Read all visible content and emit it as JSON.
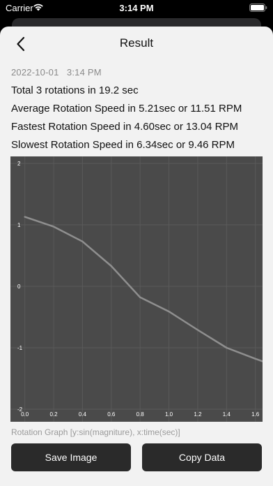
{
  "status_bar": {
    "carrier": "Carrier",
    "time": "3:14 PM"
  },
  "nav": {
    "title": "Result",
    "back_icon": "chevron-left-icon"
  },
  "result": {
    "timestamp": "2022-10-01   3:14 PM",
    "total": "Total 3 rotations in 19.2 sec",
    "average": "Average Rotation Speed in 5.21sec or 11.51 RPM",
    "fastest": "Fastest Rotation Speed in 4.60sec or 13.04 RPM",
    "slowest": "Slowest Rotation Speed in 6.34sec or 9.46 RPM"
  },
  "chart_caption": "Rotation Graph [y:sin(magniture), x:time(sec)]",
  "buttons": {
    "save": "Save Image",
    "copy": "Copy Data"
  },
  "colors": {
    "chart_background": "#4a4a4a",
    "grid": "#5a5a5a",
    "line": "#8f8f8f",
    "tick_label": "#ffffff"
  },
  "chart_data": {
    "type": "line",
    "title": "",
    "xlabel": "",
    "ylabel": "",
    "xlim": [
      -0.1,
      1.65
    ],
    "ylim": [
      -2,
      2
    ],
    "x_ticks": [
      "0.0",
      "0.2",
      "0.4",
      "0.6",
      "0.8",
      "1.0",
      "1.2",
      "1.4",
      "1.6"
    ],
    "y_ticks": [
      "-2",
      "-1",
      "0",
      "1",
      "2"
    ],
    "grid": true,
    "series": [
      {
        "x": [
          0.0,
          0.2,
          0.4,
          0.6,
          0.8,
          1.0,
          1.2,
          1.4,
          1.6,
          1.65
        ],
        "y": [
          1.13,
          0.97,
          0.73,
          0.33,
          -0.18,
          -0.41,
          -0.71,
          -1.0,
          -1.18,
          -1.22
        ]
      }
    ]
  }
}
